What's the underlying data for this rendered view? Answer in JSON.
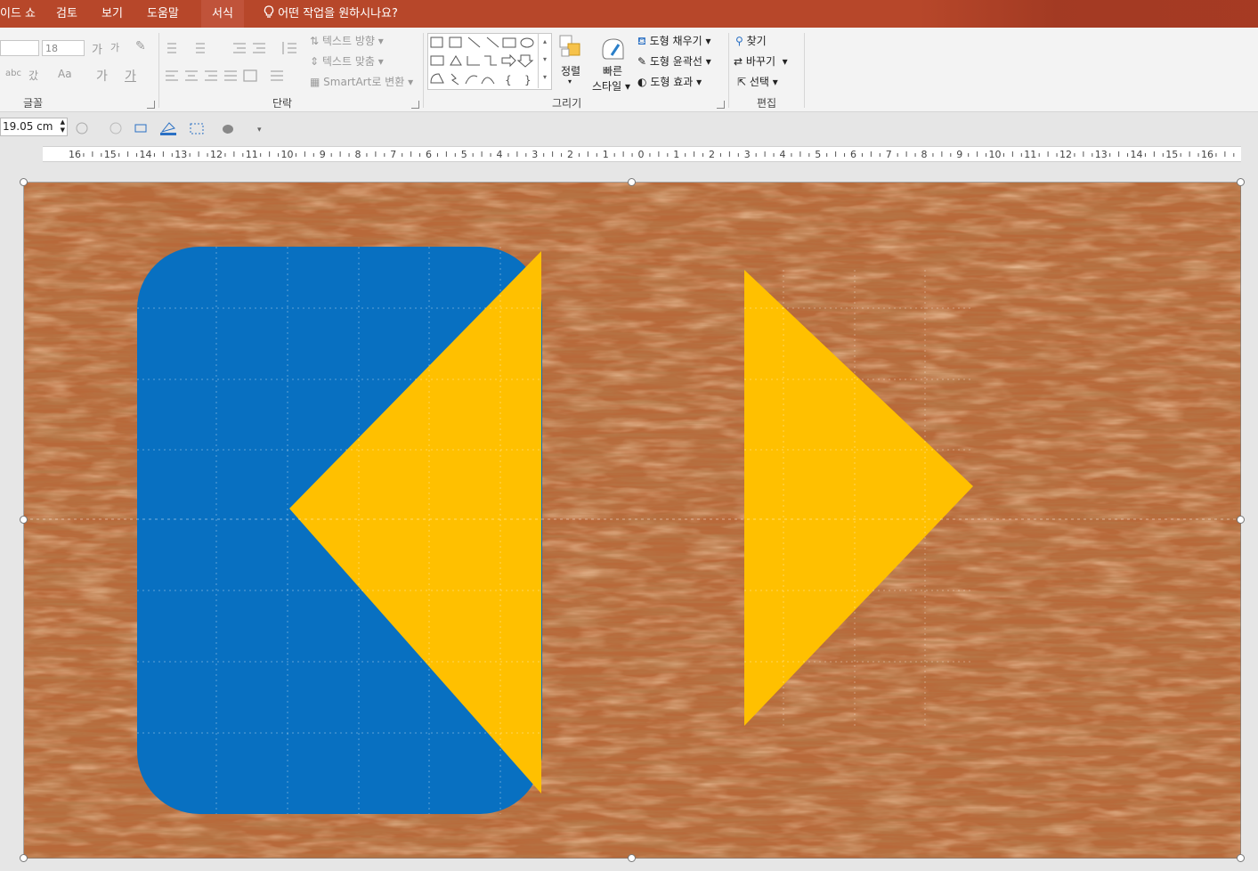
{
  "menu": {
    "tabs": [
      "이드 쇼",
      "검토",
      "보기",
      "도움말",
      "서식"
    ],
    "active_tab": "서식",
    "tell_me": "어떤 작업을 원하시나요?"
  },
  "ribbon": {
    "font_group": {
      "label": "글꼴",
      "font_size": "18",
      "aa_label": "Aa"
    },
    "paragraph_group": {
      "label": "단락",
      "text_direction": "텍스트 방향",
      "align_text": "텍스트 맞춤",
      "smartart": "SmartArt로 변환"
    },
    "drawing_group": {
      "label": "그리기",
      "arrange": "정렬",
      "quick_styles_1": "빠른",
      "quick_styles_2": "스타일",
      "shape_fill": "도형 채우기",
      "shape_outline": "도형 윤곽선",
      "shape_effects": "도형 효과"
    },
    "editing_group": {
      "label": "편집",
      "find": "찾기",
      "replace": "바꾸기",
      "select": "선택"
    }
  },
  "qat": {
    "shape_size": "19.05 cm"
  },
  "ruler": {
    "labels": [
      "16",
      "15",
      "14",
      "13",
      "12",
      "11",
      "10",
      "9",
      "8",
      "7",
      "6",
      "5",
      "4",
      "3",
      "2",
      "1",
      "0",
      "1",
      "2",
      "3",
      "4",
      "5",
      "6",
      "7",
      "8",
      "9",
      "10",
      "11",
      "12",
      "13",
      "14",
      "15",
      "16"
    ]
  },
  "colors": {
    "ribbon_accent": "#b7472a",
    "blue_shape": "#0870c1",
    "yellow_shape": "#ffc000",
    "wood_base": "#b5683a"
  }
}
